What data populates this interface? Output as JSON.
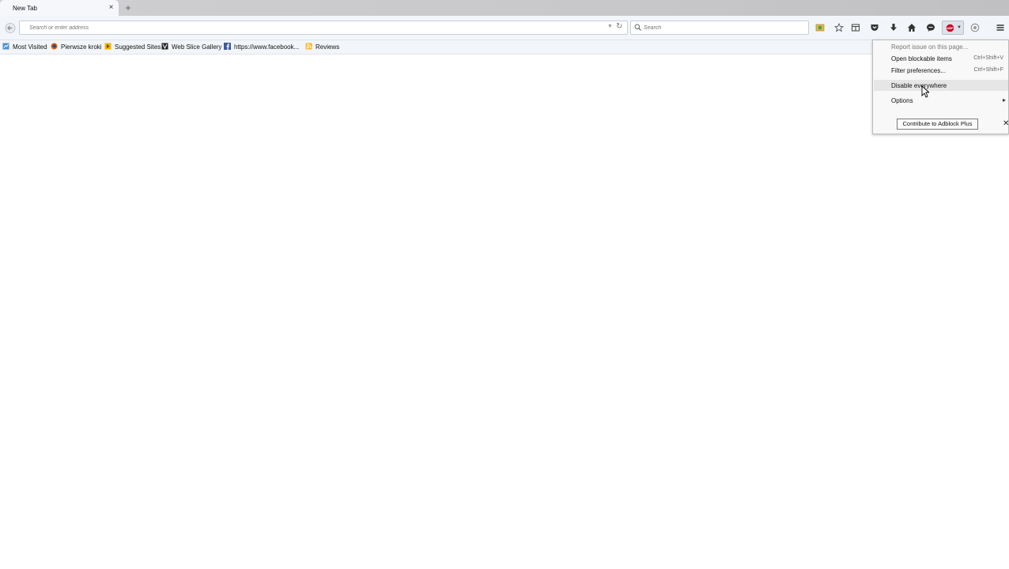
{
  "tabs": [
    {
      "title": "New Tab",
      "active": true
    }
  ],
  "navbar": {
    "url_placeholder": "Search or enter address",
    "search_placeholder": "Search"
  },
  "bookmarks": [
    {
      "label": "Most Visited",
      "icon": "most-visited-icon"
    },
    {
      "label": "Pierwsze kroki",
      "icon": "firefox-icon"
    },
    {
      "label": "Suggested Sites",
      "icon": "suggested-sites-icon"
    },
    {
      "label": "Web Slice Gallery",
      "icon": "web-slice-icon"
    },
    {
      "label": "https://www.facebook...",
      "icon": "facebook-icon"
    },
    {
      "label": "Reviews",
      "icon": "feed-icon"
    }
  ],
  "abp_menu": {
    "items": [
      {
        "label": "Report issue on this page...",
        "shortcut": "",
        "dim": true
      },
      {
        "label": "Open blockable items",
        "shortcut": "Ctrl+Shift+V"
      },
      {
        "label": "Filter preferences...",
        "shortcut": "Ctrl+Shift+F"
      },
      {
        "label": "Disable everywhere",
        "shortcut": "",
        "highlighted": true
      },
      {
        "label": "Options",
        "shortcut": "",
        "submenu": true
      }
    ],
    "contribute_label": "Contribute to Adblock Plus",
    "close_glyph": "✕"
  },
  "colors": {
    "abp_red": "#c70d2c",
    "facebook_blue": "#3b5998",
    "toolbar_bg": "#f2f5f9"
  }
}
